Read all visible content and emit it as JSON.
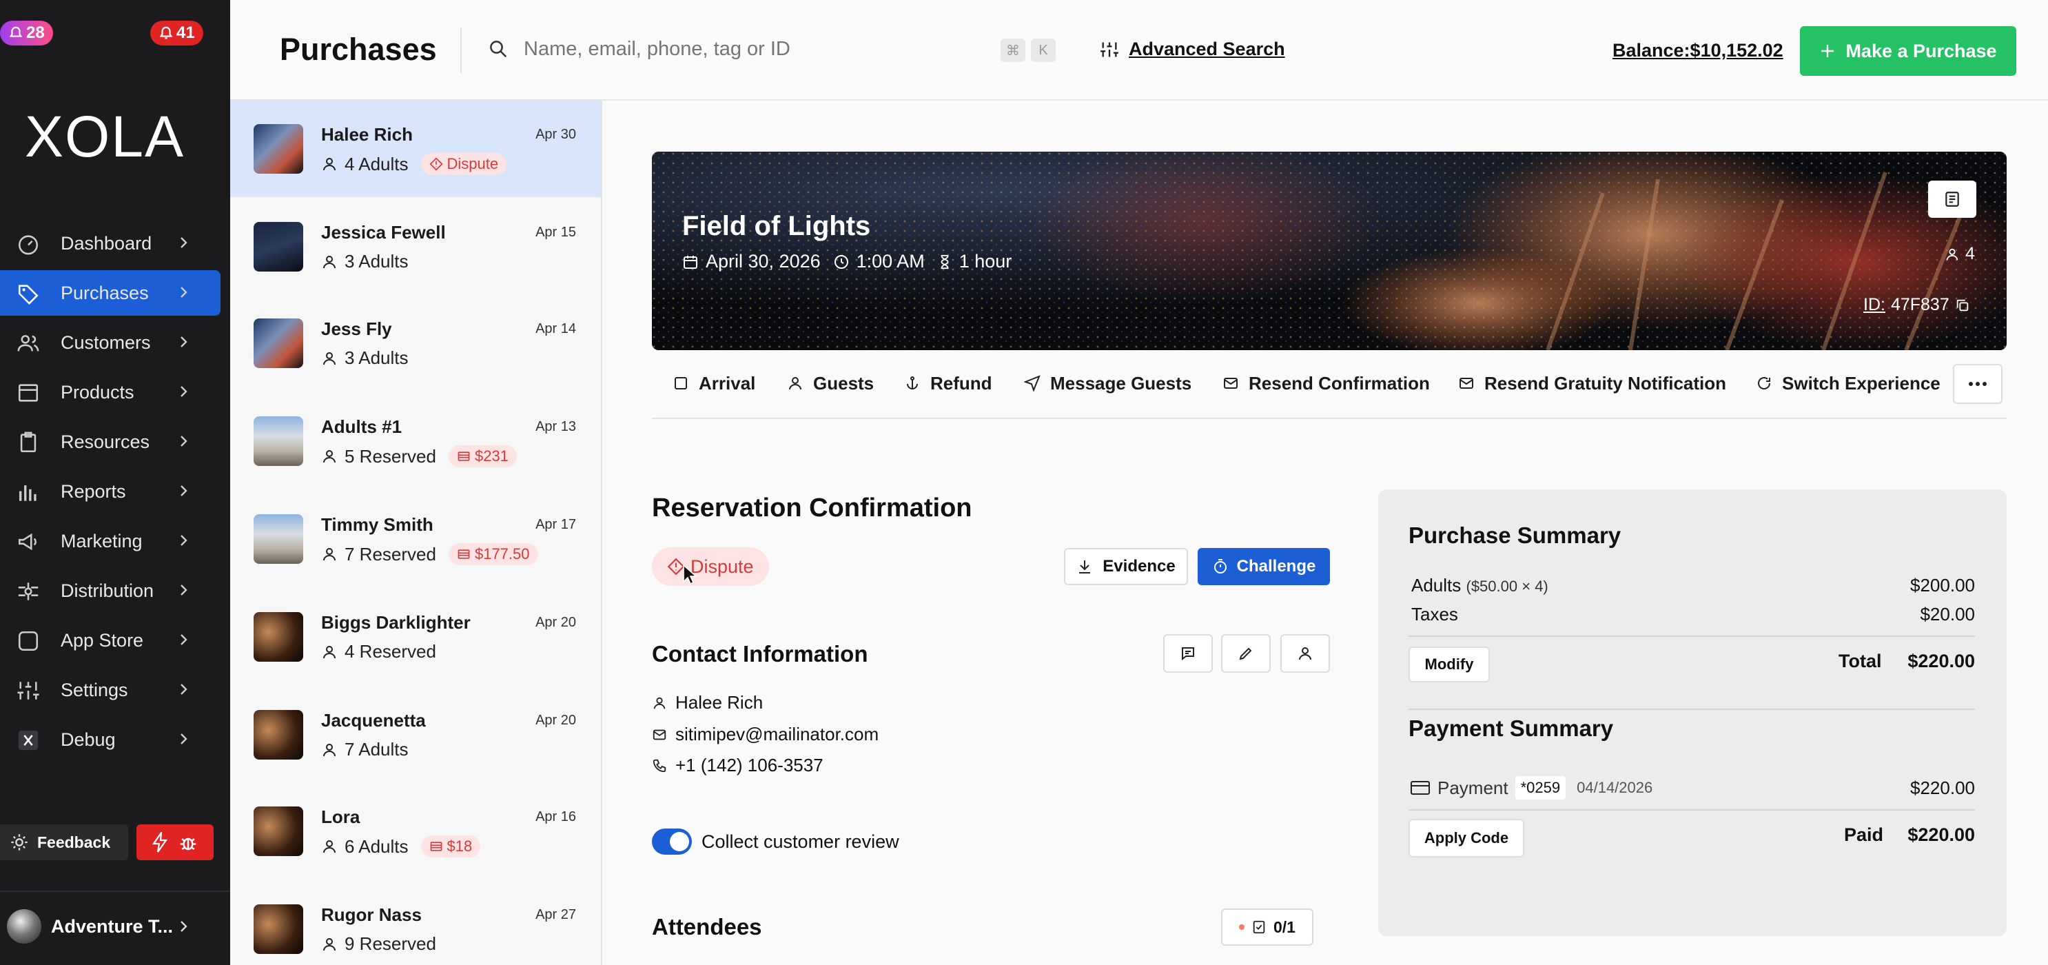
{
  "sidebar": {
    "badge_left": "28",
    "badge_right": "41",
    "logo": "XOLA",
    "nav": [
      {
        "label": "Dashboard",
        "icon": "gauge-icon"
      },
      {
        "label": "Purchases",
        "icon": "tag-icon"
      },
      {
        "label": "Customers",
        "icon": "users-icon"
      },
      {
        "label": "Products",
        "icon": "box-icon"
      },
      {
        "label": "Resources",
        "icon": "clipboard-icon"
      },
      {
        "label": "Reports",
        "icon": "bar-chart-icon"
      },
      {
        "label": "Marketing",
        "icon": "megaphone-icon"
      },
      {
        "label": "Distribution",
        "icon": "distribution-icon"
      },
      {
        "label": "App Store",
        "icon": "app-square-icon"
      },
      {
        "label": "Settings",
        "icon": "sliders-icon"
      },
      {
        "label": "Debug",
        "icon": "x-square-icon"
      }
    ],
    "feedback_label": "Feedback",
    "account_label": "Adventure T...",
    "colors": {
      "active": "#1c5ed6",
      "bg": "#1b1b1d",
      "alert": "#e02424"
    }
  },
  "header": {
    "title": "Purchases",
    "search_placeholder": "Name, email, phone, tag or ID",
    "shortcut_keys": [
      "⌘",
      "K"
    ],
    "advanced_search": "Advanced Search",
    "balance": "Balance:$10,152.02",
    "make_purchase": "Make a Purchase",
    "accent": "#24c265"
  },
  "list": [
    {
      "name": "Halee Rich",
      "date": "Apr 30",
      "sub": "4 Adults",
      "badge": "Dispute",
      "badge_icon": "dispute-icon",
      "selected": true
    },
    {
      "name": "Jessica Fewell",
      "date": "Apr 15",
      "sub": "3 Adults"
    },
    {
      "name": "Jess Fly",
      "date": "Apr 14",
      "sub": "3 Adults"
    },
    {
      "name": "Adults #1",
      "date": "Apr 13",
      "sub": "5 Reserved",
      "badge": "$231",
      "badge_icon": "money-icon"
    },
    {
      "name": "Timmy Smith",
      "date": "Apr 17",
      "sub": "7 Reserved",
      "badge": "$177.50",
      "badge_icon": "money-icon"
    },
    {
      "name": "Biggs Darklighter",
      "date": "Apr 20",
      "sub": "4 Reserved"
    },
    {
      "name": "Jacquenetta",
      "date": "Apr 20",
      "sub": "7 Adults"
    },
    {
      "name": "Lora",
      "date": "Apr 16",
      "sub": "6 Adults",
      "badge": "$18",
      "badge_icon": "money-icon"
    },
    {
      "name": "Rugor Nass",
      "date": "Apr 27",
      "sub": "9 Reserved"
    }
  ],
  "hero": {
    "title": "Field of Lights",
    "date": "April 30, 2026",
    "time": "1:00 AM",
    "duration": "1 hour",
    "guests": "4",
    "id_label": "ID:",
    "id_value": "47F837"
  },
  "tabs": [
    "Arrival",
    "Guests",
    "Refund",
    "Message Guests",
    "Resend Confirmation",
    "Resend Gratuity Notification",
    "Switch Experience"
  ],
  "reservation": {
    "title": "Reservation Confirmation",
    "status": "Dispute",
    "evidence": "Evidence",
    "challenge": "Challenge"
  },
  "contact": {
    "title": "Contact Information",
    "name": "Halee Rich",
    "email": "sitimipev@mailinator.com",
    "phone": "+1 (142) 106-3537",
    "review_toggle": "Collect customer review",
    "review_enabled": true
  },
  "attendees": {
    "title": "Attendees",
    "count": "0/1"
  },
  "purchase_summary": {
    "title": "Purchase Summary",
    "adults_label": "Adults",
    "adults_detail": "($50.00 × 4)",
    "adults_amount": "$200.00",
    "taxes_label": "Taxes",
    "taxes_amount": "$20.00",
    "modify": "Modify",
    "total_label": "Total",
    "total_amount": "$220.00"
  },
  "payment_summary": {
    "title": "Payment Summary",
    "payment_label": "Payment",
    "card": "*0259",
    "date": "04/14/2026",
    "amount": "$220.00",
    "apply_code": "Apply Code",
    "paid_label": "Paid",
    "paid_amount": "$220.00"
  }
}
